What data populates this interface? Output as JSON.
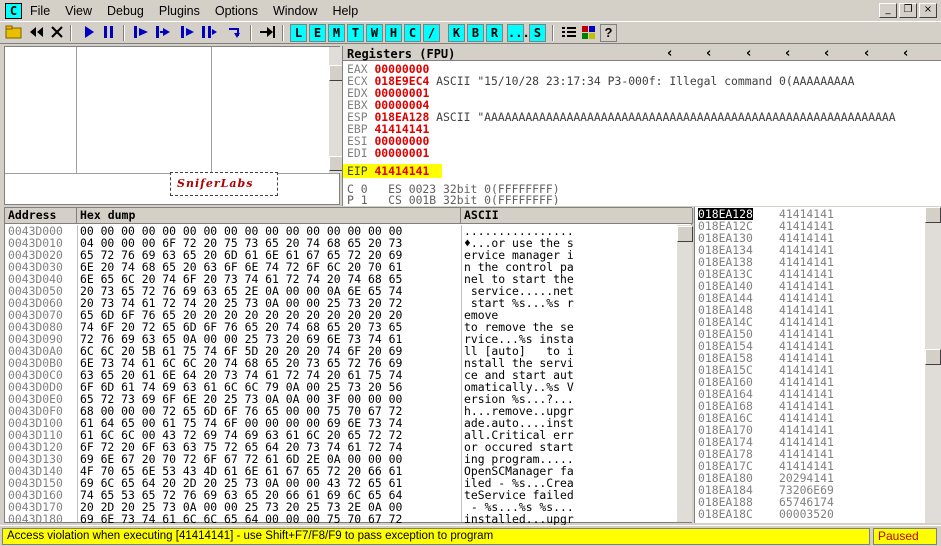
{
  "app": {
    "icon_letter": "C"
  },
  "menu": [
    "File",
    "View",
    "Debug",
    "Plugins",
    "Options",
    "Window",
    "Help"
  ],
  "window_controls": [
    "_",
    "❐",
    "×"
  ],
  "toolbar": {
    "letter_buttons": [
      "L",
      "E",
      "M",
      "T",
      "W",
      "H",
      "C",
      "/",
      "K",
      "B",
      "R",
      "...",
      "S"
    ],
    "help_label": "?"
  },
  "logo_text": "SniferLabs",
  "registers": {
    "title": "Registers (FPU)",
    "rows": [
      {
        "name": "EAX",
        "value": "00000000",
        "comment": ""
      },
      {
        "name": "ECX",
        "value": "018E9EC4",
        "comment": "ASCII \"15/10/28 23:17:34 P3-000f: Illegal command 0(AAAAAAAAA"
      },
      {
        "name": "EDX",
        "value": "00000001",
        "comment": ""
      },
      {
        "name": "EBX",
        "value": "00000004",
        "comment": ""
      },
      {
        "name": "ESP",
        "value": "018EA128",
        "comment": "ASCII \"AAAAAAAAAAAAAAAAAAAAAAAAAAAAAAAAAAAAAAAAAAAAAAAAAAAAAAAAAAAA"
      },
      {
        "name": "EBP",
        "value": "41414141",
        "comment": ""
      },
      {
        "name": "ESI",
        "value": "00000000",
        "comment": ""
      },
      {
        "name": "EDI",
        "value": "00000001",
        "comment": ""
      }
    ],
    "eip": {
      "name": "EIP",
      "value": "41414141"
    },
    "flags": [
      "C 0   ES 0023 32bit 0(FFFFFFFF)",
      "P 1   CS 001B 32bit 0(FFFFFFFF)"
    ]
  },
  "hexdump": {
    "headers": {
      "address": "Address",
      "hex": "Hex dump",
      "ascii": "ASCII"
    },
    "rows": [
      {
        "addr": "0043D000",
        "hex": "00 00 00 00 00 00 00 00 00 00 00 00 00 00 00 00",
        "ascii": "................"
      },
      {
        "addr": "0043D010",
        "hex": "04 00 00 00 6F 72 20 75 73 65 20 74 68 65 20 73",
        "ascii": "♦...or use the s"
      },
      {
        "addr": "0043D020",
        "hex": "65 72 76 69 63 65 20 6D 61 6E 61 67 65 72 20 69",
        "ascii": "ervice manager i"
      },
      {
        "addr": "0043D030",
        "hex": "6E 20 74 68 65 20 63 6F 6E 74 72 6F 6C 20 70 61",
        "ascii": "n the control pa"
      },
      {
        "addr": "0043D040",
        "hex": "6E 65 6C 20 74 6F 20 73 74 61 72 74 20 74 68 65",
        "ascii": "nel to start the"
      },
      {
        "addr": "0043D050",
        "hex": "20 73 65 72 76 69 63 65 2E 0A 00 00 0A 6E 65 74",
        "ascii": " service.....net"
      },
      {
        "addr": "0043D060",
        "hex": "20 73 74 61 72 74 20 25 73 0A 00 00 25 73 20 72",
        "ascii": " start %s...%s r"
      },
      {
        "addr": "0043D070",
        "hex": "65 6D 6F 76 65 20 20 20 20 20 20 20 20 20 20 20",
        "ascii": "emove           "
      },
      {
        "addr": "0043D080",
        "hex": "74 6F 20 72 65 6D 6F 76 65 20 74 68 65 20 73 65",
        "ascii": "to remove the se"
      },
      {
        "addr": "0043D090",
        "hex": "72 76 69 63 65 0A 00 00 25 73 20 69 6E 73 74 61",
        "ascii": "rvice...%s insta"
      },
      {
        "addr": "0043D0A0",
        "hex": "6C 6C 20 5B 61 75 74 6F 5D 20 20 20 74 6F 20 69",
        "ascii": "ll [auto]   to i"
      },
      {
        "addr": "0043D0B0",
        "hex": "6E 73 74 61 6C 6C 20 74 68 65 20 73 65 72 76 69",
        "ascii": "nstall the servi"
      },
      {
        "addr": "0043D0C0",
        "hex": "63 65 20 61 6E 64 20 73 74 61 72 74 20 61 75 74",
        "ascii": "ce and start aut"
      },
      {
        "addr": "0043D0D0",
        "hex": "6F 6D 61 74 69 63 61 6C 6C 79 0A 00 25 73 20 56",
        "ascii": "omatically..%s V"
      },
      {
        "addr": "0043D0E0",
        "hex": "65 72 73 69 6F 6E 20 25 73 0A 0A 00 3F 00 00 00",
        "ascii": "ersion %s...?..."
      },
      {
        "addr": "0043D0F0",
        "hex": "68 00 00 00 72 65 6D 6F 76 65 00 00 75 70 67 72",
        "ascii": "h...remove..upgr"
      },
      {
        "addr": "0043D100",
        "hex": "61 64 65 00 61 75 74 6F 00 00 00 00 69 6E 73 74",
        "ascii": "ade.auto....inst"
      },
      {
        "addr": "0043D110",
        "hex": "61 6C 6C 00 43 72 69 74 69 63 61 6C 20 65 72 72",
        "ascii": "all.Critical err"
      },
      {
        "addr": "0043D120",
        "hex": "6F 72 20 6F 63 63 75 72 65 64 20 73 74 61 72 74",
        "ascii": "or occured start"
      },
      {
        "addr": "0043D130",
        "hex": "69 6E 67 20 70 72 6F 67 72 61 6D 2E 0A 00 00 00",
        "ascii": "ing program....."
      },
      {
        "addr": "0043D140",
        "hex": "4F 70 65 6E 53 43 4D 61 6E 61 67 65 72 20 66 61",
        "ascii": "OpenSCManager fa"
      },
      {
        "addr": "0043D150",
        "hex": "69 6C 65 64 20 2D 20 25 73 0A 00 00 43 72 65 61",
        "ascii": "iled - %s...Crea"
      },
      {
        "addr": "0043D160",
        "hex": "74 65 53 65 72 76 69 63 65 20 66 61 69 6C 65 64",
        "ascii": "teService failed"
      },
      {
        "addr": "0043D170",
        "hex": "20 2D 20 25 73 0A 00 00 25 73 20 25 73 2E 0A 00",
        "ascii": " - %s...%s %s..."
      },
      {
        "addr": "0043D180",
        "hex": "69 6E 73 74 61 6C 6C 65 64 00 00 00 75 70 67 72",
        "ascii": "installed...upgr"
      }
    ]
  },
  "stack": {
    "rows": [
      {
        "addr": "018EA128",
        "value": "41414141",
        "selected": true
      },
      {
        "addr": "018EA12C",
        "value": "41414141"
      },
      {
        "addr": "018EA130",
        "value": "41414141"
      },
      {
        "addr": "018EA134",
        "value": "41414141"
      },
      {
        "addr": "018EA138",
        "value": "41414141"
      },
      {
        "addr": "018EA13C",
        "value": "41414141"
      },
      {
        "addr": "018EA140",
        "value": "41414141"
      },
      {
        "addr": "018EA144",
        "value": "41414141"
      },
      {
        "addr": "018EA148",
        "value": "41414141"
      },
      {
        "addr": "018EA14C",
        "value": "41414141"
      },
      {
        "addr": "018EA150",
        "value": "41414141"
      },
      {
        "addr": "018EA154",
        "value": "41414141"
      },
      {
        "addr": "018EA158",
        "value": "41414141"
      },
      {
        "addr": "018EA15C",
        "value": "41414141"
      },
      {
        "addr": "018EA160",
        "value": "41414141"
      },
      {
        "addr": "018EA164",
        "value": "41414141"
      },
      {
        "addr": "018EA168",
        "value": "41414141"
      },
      {
        "addr": "018EA16C",
        "value": "41414141"
      },
      {
        "addr": "018EA170",
        "value": "41414141"
      },
      {
        "addr": "018EA174",
        "value": "41414141"
      },
      {
        "addr": "018EA178",
        "value": "41414141"
      },
      {
        "addr": "018EA17C",
        "value": "41414141"
      },
      {
        "addr": "018EA180",
        "value": "20294141"
      },
      {
        "addr": "018EA184",
        "value": "73206E69"
      },
      {
        "addr": "018EA188",
        "value": "65746174"
      },
      {
        "addr": "018EA18C",
        "value": "00003520"
      }
    ]
  },
  "status": {
    "message": "Access violation when executing [41414141] - use Shift+F7/F8/F9 to pass exception to program",
    "state": "Paused"
  },
  "colors": {
    "register_changed": "#e00000",
    "status_bg": "#ffff00",
    "toolbar_letter_bg": "#00ffff"
  }
}
